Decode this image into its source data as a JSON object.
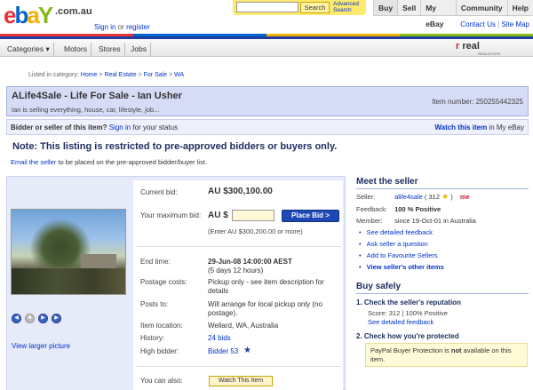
{
  "header": {
    "logo_e": "e",
    "logo_b": "b",
    "logo_a": "a",
    "logo_y": "Y",
    "logo_domain": ".com.au",
    "sign_in": "Sign in",
    "or": "or",
    "register": "register",
    "search_button": "Search",
    "advanced_search": "Advanced Search",
    "nav": [
      "Buy",
      "Sell",
      "My eBay",
      "Community",
      "Help"
    ],
    "contact_us": "Contact Us",
    "site_map": "Site Map"
  },
  "catbar": {
    "items": [
      "Categories ▾",
      "Motors",
      "Stores",
      "Jobs"
    ],
    "badge_r": "r",
    "badge_text": "real",
    "badge_sub": "REALESTATE"
  },
  "breadcrumb": {
    "prefix": "Listed in category:",
    "path": [
      "Home",
      "Real Estate",
      "For Sale",
      "WA"
    ],
    "sep": ">"
  },
  "listing": {
    "title": "ALife4Sale - Life For Sale - Ian Usher",
    "subtitle": "Ian is selling everything, house, car, lifestyle, job...",
    "item_number_label": "Item number:",
    "item_number": "250255442325"
  },
  "status": {
    "question": "Bidder or seller of this item?",
    "sign_in": "Sign in",
    "for_status": "for your status",
    "watch_link": "Watch this item",
    "watch_suffix": "in My eBay"
  },
  "notice": "Note: This listing is restricted to pre-approved bidders or buyers only.",
  "email_seller": {
    "link": "Email the seller",
    "text": "to be placed on the pre-approved bidder/buyer list."
  },
  "photo": {
    "view_larger": "View larger picture",
    "controls": [
      "◀",
      "■",
      "▶",
      "▶"
    ]
  },
  "bid": {
    "current_bid_label": "Current bid:",
    "current_bid": "AU $300,100.00",
    "max_bid_label": "Your maximum bid:",
    "max_bid_currency": "AU $",
    "place_bid": "Place Bid >",
    "hint": "(Enter AU $300,200.00 or more)",
    "end_time_label": "End time:",
    "end_time": "29-Jun-08 14:00:00 AEST",
    "time_left": "(5 days 12 hours)",
    "postage_label": "Postage costs:",
    "postage": "Pickup only - see item description for details",
    "posts_to_label": "Posts to:",
    "posts_to": "Will arrange for local pickup only (no postage).",
    "location_label": "Item location:",
    "location": "Wellard, WA, Australia",
    "history_label": "History:",
    "history": "24 bids",
    "high_bidder_label": "High bidder:",
    "high_bidder": "Bidder 53",
    "you_can_also_label": "You can also:",
    "watch_button": "Watch This Item"
  },
  "seller": {
    "heading": "Meet the seller",
    "seller_label": "Seller:",
    "seller_name": "alife4sale",
    "feedback_count": "( 312",
    "feedback_close": ")",
    "feedback_label": "Feedback:",
    "feedback_pct": "100 % Positive",
    "member_label": "Member:",
    "member_since": "since 19-Oct-01 in Australia",
    "links": [
      "See detailed feedback",
      "Ask seller a question",
      "Add to Favourite Sellers",
      "View seller's other items"
    ]
  },
  "buy_safely": {
    "heading": "Buy safely",
    "step1": "1.  Check the seller's reputation",
    "score": "Score: 312 | 100% Positive",
    "see_feedback": "See detailed feedback",
    "step2": "2.  Check how you're protected",
    "paypal_text1": "PayPal Buyer Protection is",
    "paypal_not": "not",
    "paypal_text2": "available on this item."
  },
  "colors": {
    "ebay_red": "#e53238",
    "ebay_blue": "#0064d2",
    "ebay_yellow": "#f5af02",
    "ebay_green": "#86b817",
    "place_bid_bg": "#1f47b5",
    "title_bg": "#d6dcf5"
  }
}
